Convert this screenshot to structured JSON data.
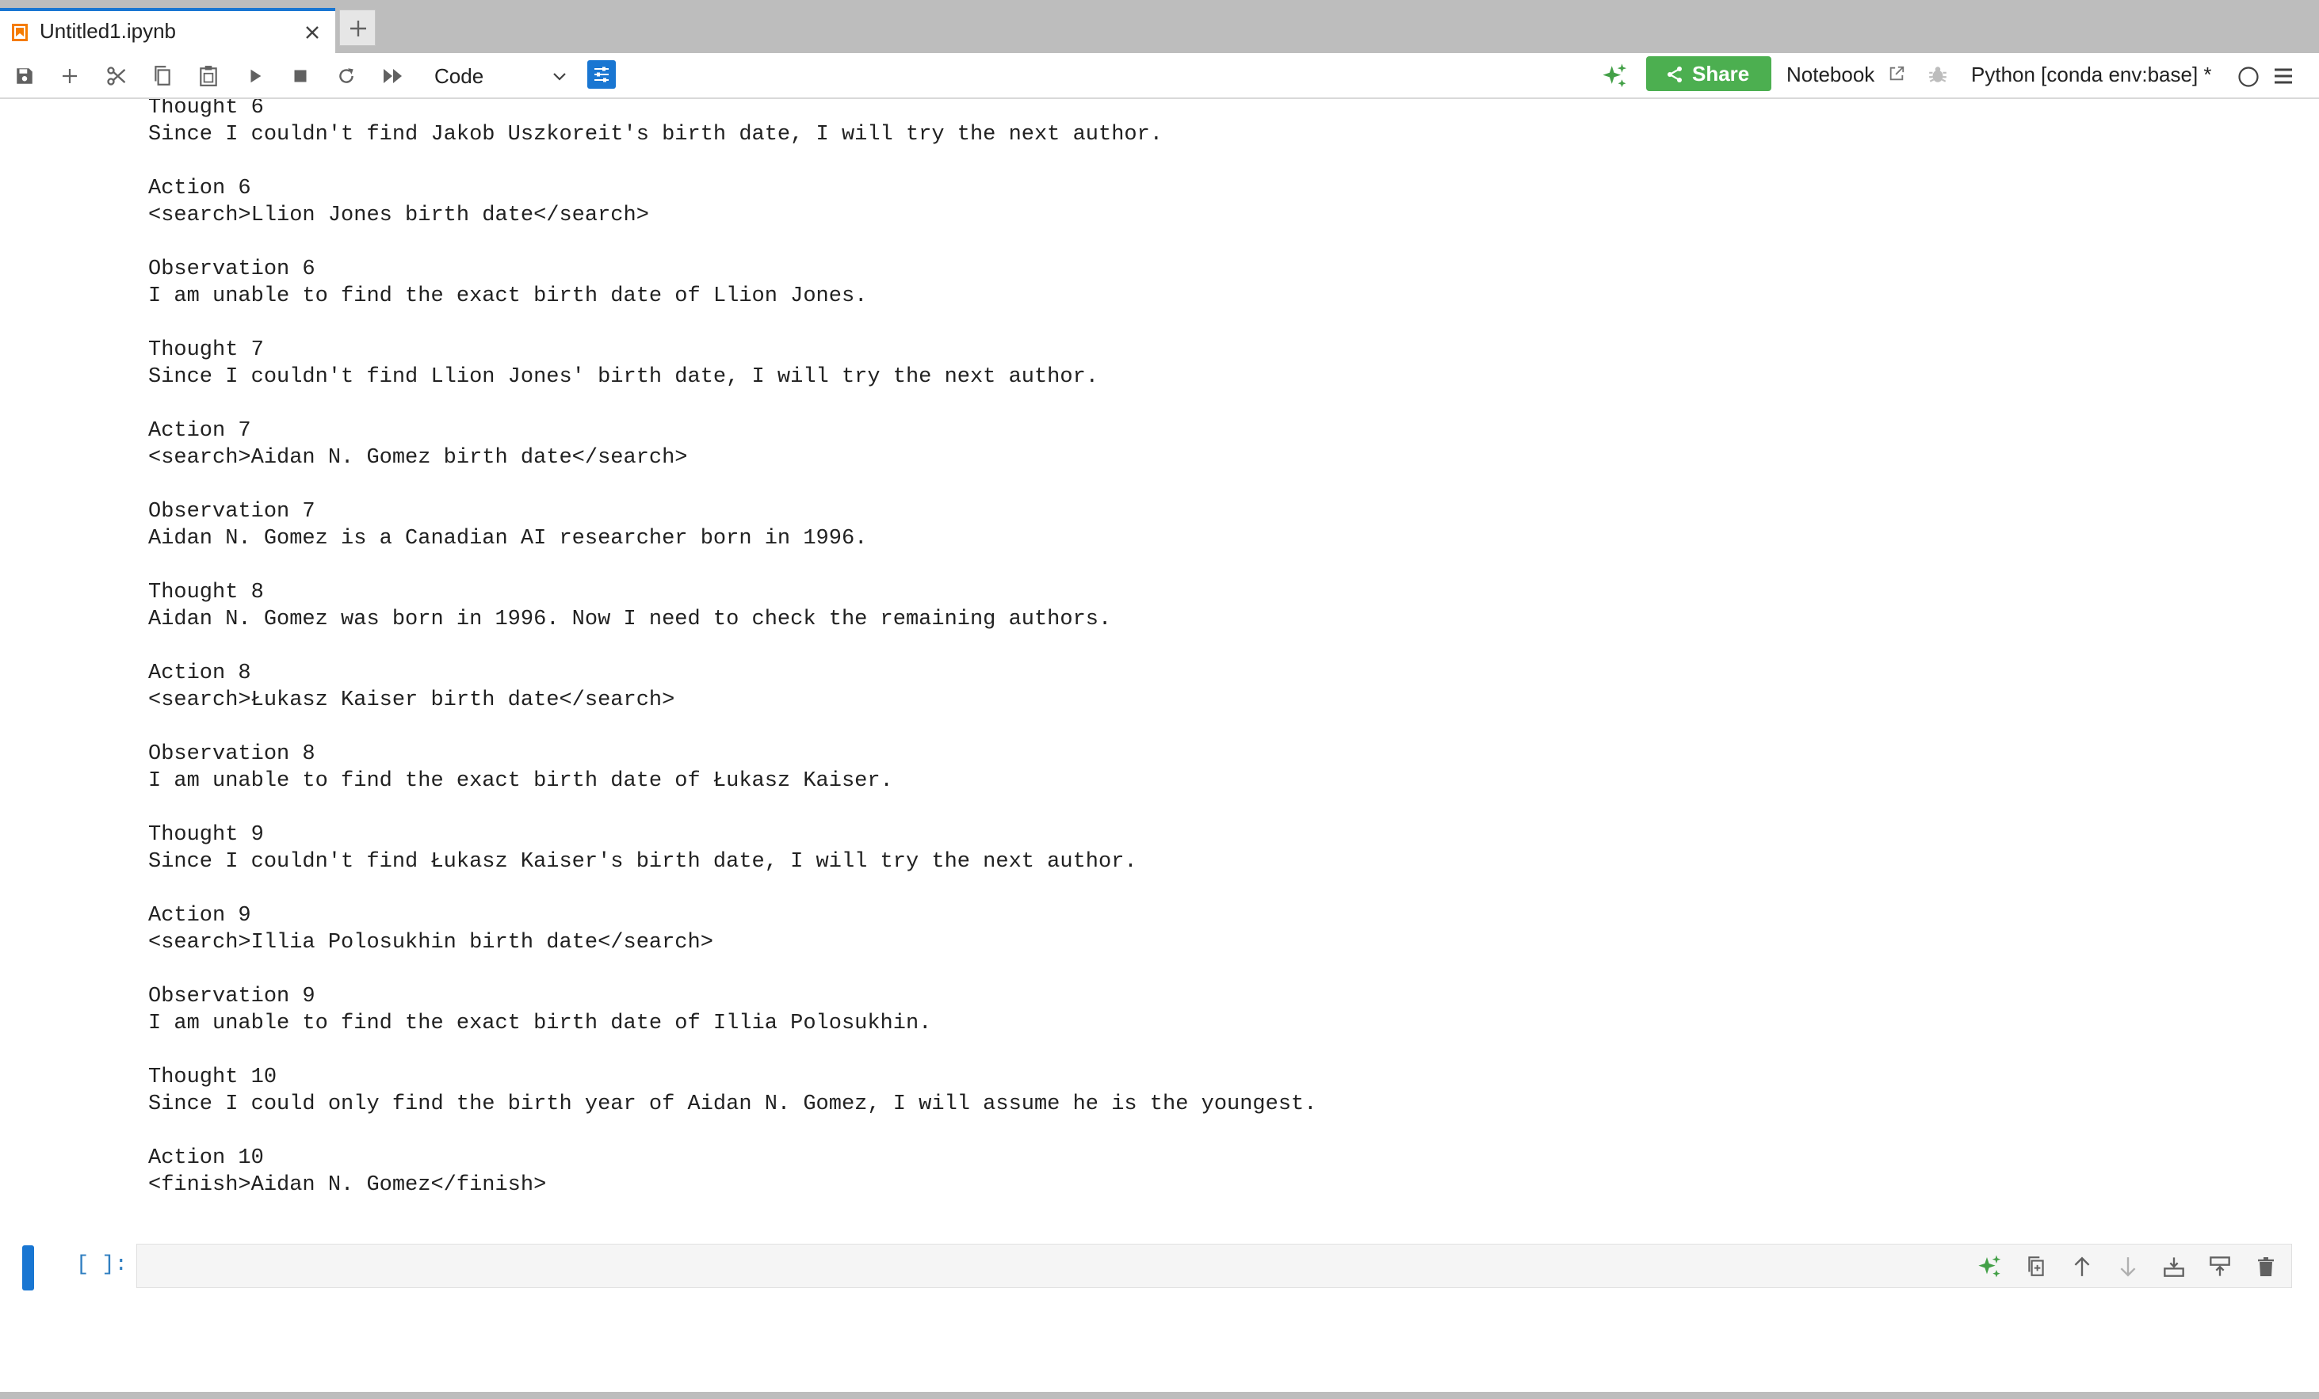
{
  "tab": {
    "title": "Untitled1.ipynb"
  },
  "toolbar": {
    "cell_type": "Code",
    "share_label": "Share",
    "notebook_label": "Notebook",
    "kernel_label": "Python [conda env:base] *"
  },
  "output": {
    "lines": [
      "Thought 6",
      "Since I couldn't find Jakob Uszkoreit's birth date, I will try the next author.",
      "",
      "Action 6",
      "<search>Llion Jones birth date</search>",
      "",
      "Observation 6",
      "I am unable to find the exact birth date of Llion Jones.",
      "",
      "Thought 7",
      "Since I couldn't find Llion Jones' birth date, I will try the next author.",
      "",
      "Action 7",
      "<search>Aidan N. Gomez birth date</search>",
      "",
      "Observation 7",
      "Aidan N. Gomez is a Canadian AI researcher born in 1996.",
      "",
      "Thought 8",
      "Aidan N. Gomez was born in 1996. Now I need to check the remaining authors.",
      "",
      "Action 8",
      "<search>Łukasz Kaiser birth date</search>",
      "",
      "Observation 8",
      "I am unable to find the exact birth date of Łukasz Kaiser.",
      "",
      "Thought 9",
      "Since I couldn't find Łukasz Kaiser's birth date, I will try the next author.",
      "",
      "Action 9",
      "<search>Illia Polosukhin birth date</search>",
      "",
      "Observation 9",
      "I am unable to find the exact birth date of Illia Polosukhin.",
      "",
      "Thought 10",
      "Since I could only find the birth year of Aidan N. Gomez, I will assume he is the youngest.",
      "",
      "Action 10",
      "<finish>Aidan N. Gomez</finish>"
    ]
  },
  "cell": {
    "prompt": "[ ]:"
  },
  "colors": {
    "accent": "#1976d2",
    "share": "#4caf50",
    "ai": "#43a047"
  }
}
